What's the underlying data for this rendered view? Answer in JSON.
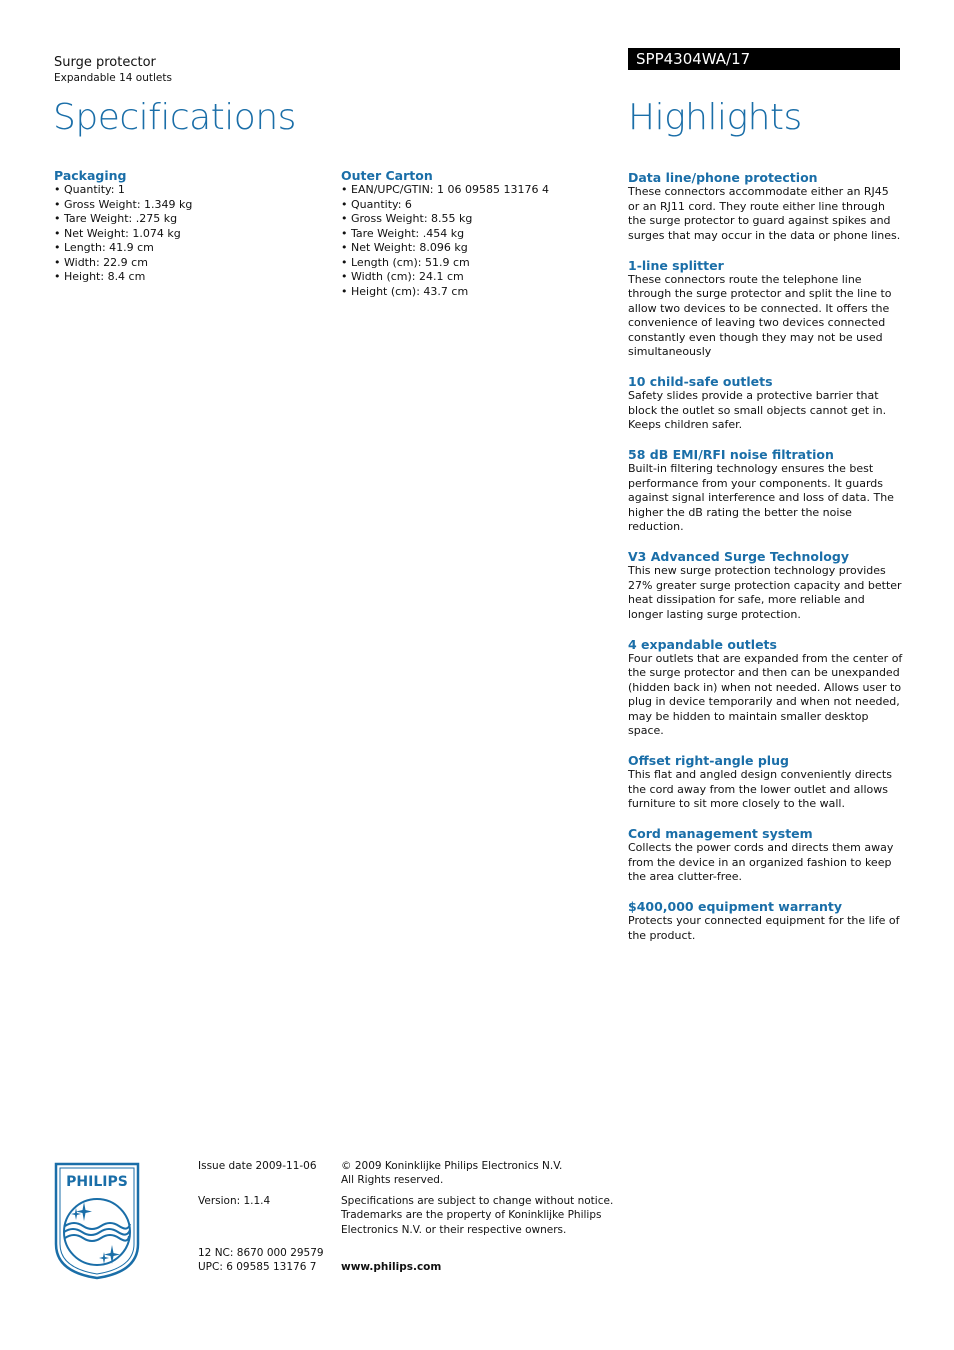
{
  "header": {
    "product_name": "Surge protector",
    "product_subtitle": "Expandable 14 outlets",
    "model_number": "SPP4304WA/17"
  },
  "specifications": {
    "title": "Specifications",
    "sections": [
      {
        "heading": "Packaging",
        "items": [
          "Quantity: 1",
          "Gross Weight: 1.349 kg",
          "Tare Weight: .275 kg",
          "Net Weight: 1.074 kg",
          "Length: 41.9 cm",
          "Width: 22.9 cm",
          "Height: 8.4 cm"
        ]
      },
      {
        "heading": "Outer Carton",
        "items": [
          "EAN/UPC/GTIN: 1 06 09585 13176 4",
          "Quantity: 6",
          "Gross Weight: 8.55 kg",
          "Tare Weight: .454 kg",
          "Net Weight: 8.096 kg",
          "Length (cm): 51.9 cm",
          "Width (cm): 24.1 cm",
          "Height (cm): 43.7 cm"
        ]
      }
    ]
  },
  "highlights": {
    "title": "Highlights",
    "items": [
      {
        "heading": "Data line/phone protection",
        "text": "These connectors accommodate either an RJ45 or an RJ11 cord. They route either line through the surge protector to guard against spikes and surges that may occur in the data or phone lines."
      },
      {
        "heading": "1-line splitter",
        "text": "These connectors route the telephone line through the surge protector and split the line to allow two devices to be connected. It offers the convenience of leaving two devices connected constantly even though they may not be used simultaneously"
      },
      {
        "heading": "10 child-safe outlets",
        "text": "Safety slides provide a protective barrier that block the outlet so small objects cannot get in. Keeps children safer."
      },
      {
        "heading": "58 dB EMI/RFI noise filtration",
        "text": "Built-in filtering technology ensures the best performance from your components. It guards against signal interference and loss of data. The higher the dB rating the better the noise reduction."
      },
      {
        "heading": "V3 Advanced Surge Technology",
        "text": "This new surge protection technology provides 27% greater surge protection capacity and better heat dissipation for safe, more reliable and longer lasting surge protection."
      },
      {
        "heading": "4 expandable outlets",
        "text": "Four outlets that are expanded from the center of the surge protector and then can be unexpanded (hidden back in) when not needed. Allows user to plug in device temporarily and when not needed, may be hidden to maintain smaller desktop space."
      },
      {
        "heading": "Offset right-angle plug",
        "text": "This flat and angled design conveniently directs the cord away from the lower outlet and allows furniture to sit more closely to the wall."
      },
      {
        "heading": "Cord management system",
        "text": "Collects the power cords and directs them away from the device in an organized fashion to keep the area clutter-free."
      },
      {
        "heading": "$400,000 equipment warranty",
        "text": "Protects your connected equipment for the life of the product."
      }
    ]
  },
  "footer": {
    "logo_text": "PHILIPS",
    "issue_date": "Issue date 2009-11-06",
    "version": "Version: 1.1.4",
    "nc": "12 NC: 8670 000 29579",
    "upc": "UPC: 6 09585 13176 7",
    "copyright_line1": "© 2009 Koninklijke Philips Electronics N.V.",
    "copyright_line2": "All Rights reserved.",
    "disclaimer_line1": "Specifications are subject to change without notice.",
    "disclaimer_line2": "Trademarks are the property of Koninklijke Philips",
    "disclaimer_line3": "Electronics N.V. or their respective owners.",
    "website": "www.philips.com"
  },
  "colors": {
    "accent": "#1a6ea8",
    "model_bar": "#000000"
  }
}
